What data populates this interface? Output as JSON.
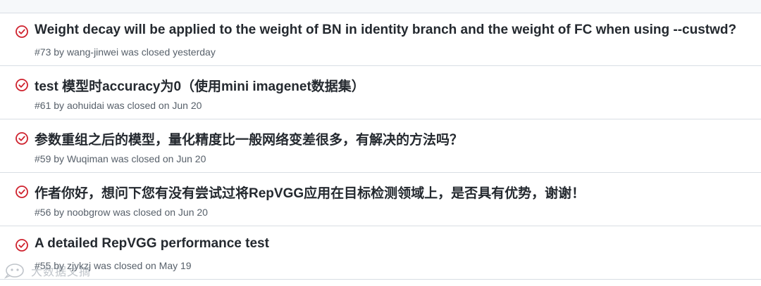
{
  "issues": [
    {
      "title": "Weight decay will be applied to the weight of BN in identity branch and the weight of FC when using --custwd?",
      "number": "#73",
      "by": "by",
      "author": "wang-jinwei",
      "closed_text": "was closed yesterday"
    },
    {
      "title": "test 模型时accuracy为0（使用mini imagenet数据集）",
      "number": "#61",
      "by": "by",
      "author": "aohuidai",
      "closed_text": "was closed on Jun 20"
    },
    {
      "title": "参数重组之后的模型，量化精度比一般网络变差很多，有解决的方法吗？",
      "number": "#59",
      "by": "by",
      "author": "Wuqiman",
      "closed_text": "was closed on Jun 20"
    },
    {
      "title": "作者你好，想问下您有没有尝试过将RepVGG应用在目标检测领域上，是否具有优势，谢谢！",
      "number": "#56",
      "by": "by",
      "author": "noobgrow",
      "closed_text": "was closed on Jun 20"
    },
    {
      "title": "A detailed RepVGG performance test",
      "number": "#55",
      "by": "by",
      "author": "zjykzj",
      "closed_text": "was closed on May 19"
    }
  ],
  "watermark": {
    "text": "大数据文摘"
  },
  "colors": {
    "closed_icon": "#cf222e",
    "title": "#24292f",
    "meta": "#57606a",
    "border": "#d8dee4"
  }
}
